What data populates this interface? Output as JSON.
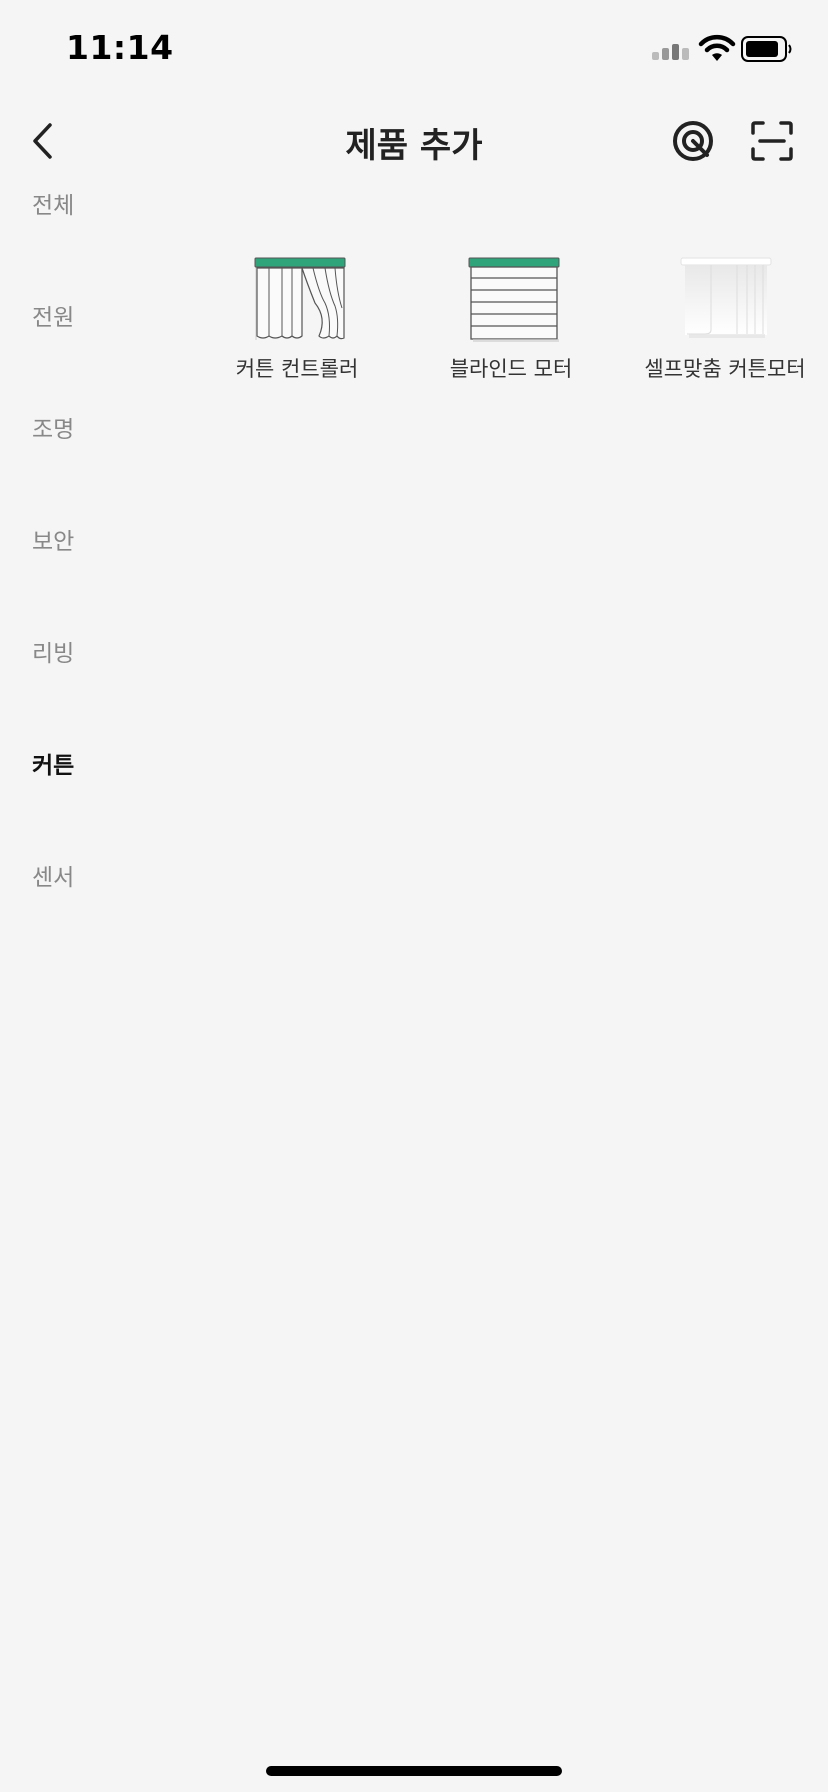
{
  "status_bar": {
    "time": "11:14"
  },
  "header": {
    "title": "제품 추가"
  },
  "categories": [
    {
      "label": "전체"
    },
    {
      "label": "전원"
    },
    {
      "label": "조명"
    },
    {
      "label": "보안"
    },
    {
      "label": "리빙"
    },
    {
      "label": "커튼",
      "active": true
    },
    {
      "label": "센서"
    }
  ],
  "products": [
    {
      "name": "커튼 컨트롤러",
      "icon": "curtain-controller-icon"
    },
    {
      "name": "블라인드 모터",
      "icon": "blind-motor-icon"
    },
    {
      "name": "셀프맞춤 커튼모터",
      "icon": "self-fit-curtain-motor-icon"
    }
  ],
  "colors": {
    "accent": "#2fa37a",
    "background": "#f5f5f5"
  }
}
